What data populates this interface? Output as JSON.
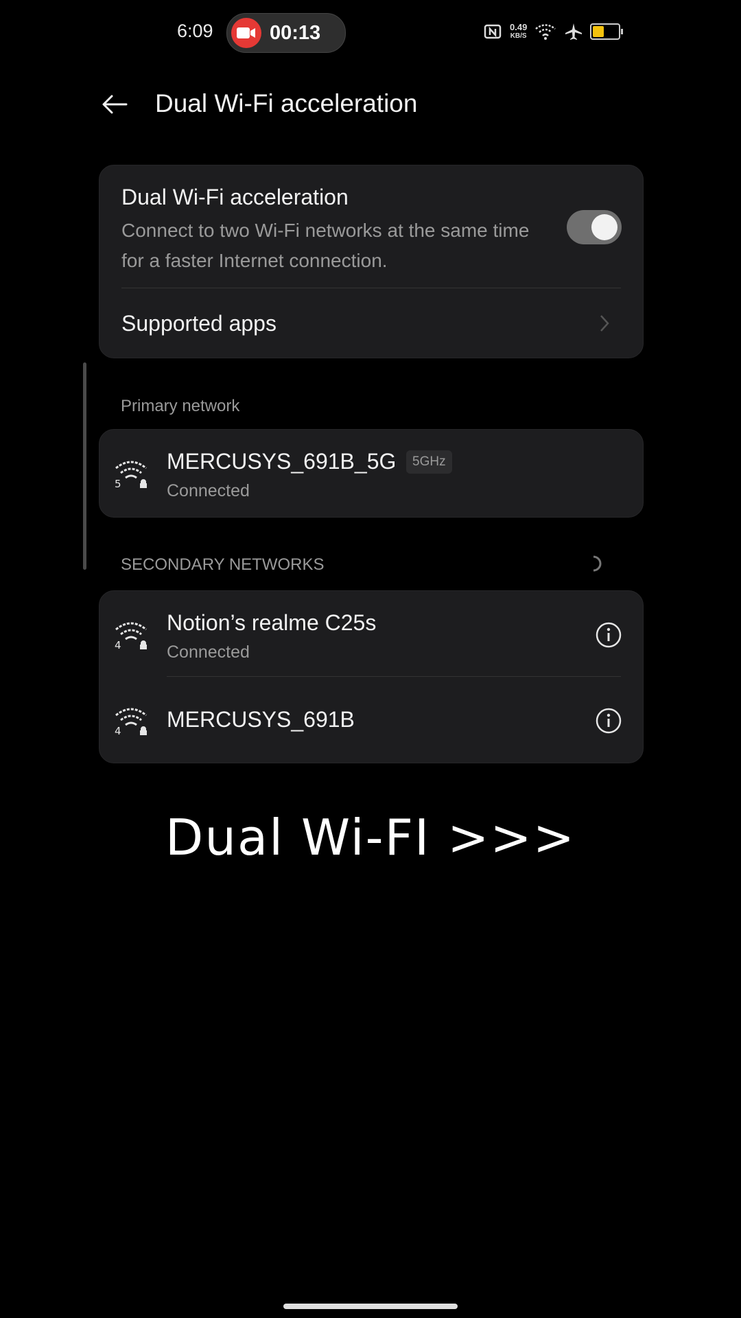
{
  "status_bar": {
    "time": "6:09",
    "recording_time": "00:13",
    "net_speed_value": "0.49",
    "net_speed_unit": "KB/S",
    "battery_level": 0.45,
    "icons": [
      "nfc-icon",
      "wifi-icon",
      "airplane-icon",
      "battery-icon"
    ]
  },
  "header": {
    "title": "Dual Wi-Fi acceleration"
  },
  "settings": {
    "dual_wifi": {
      "title": "Dual Wi-Fi acceleration",
      "description": "Connect to two Wi-Fi networks at the same time for a faster Internet connection.",
      "enabled": true
    },
    "supported_apps": {
      "label": "Supported apps"
    }
  },
  "primary_network": {
    "section_label": "Primary network",
    "name": "MERCUSYS_691B_5G",
    "band": "5GHz",
    "status": "Connected",
    "icon_badge": "5"
  },
  "secondary_networks": {
    "section_label": "SECONDARY NETWORKS",
    "items": [
      {
        "name": "Notion’s realme C25s",
        "status": "Connected",
        "icon_badge": "4"
      },
      {
        "name": "MERCUSYS_691B",
        "status": "",
        "icon_badge": "4"
      }
    ]
  },
  "overlay": {
    "caption": "Dual Wi-FI >>>"
  },
  "colors": {
    "background": "#000000",
    "card": "#1d1d1f",
    "recording_red": "#e53935",
    "battery_yellow": "#f4c20d",
    "toggle_track": "#6f6f6f"
  }
}
